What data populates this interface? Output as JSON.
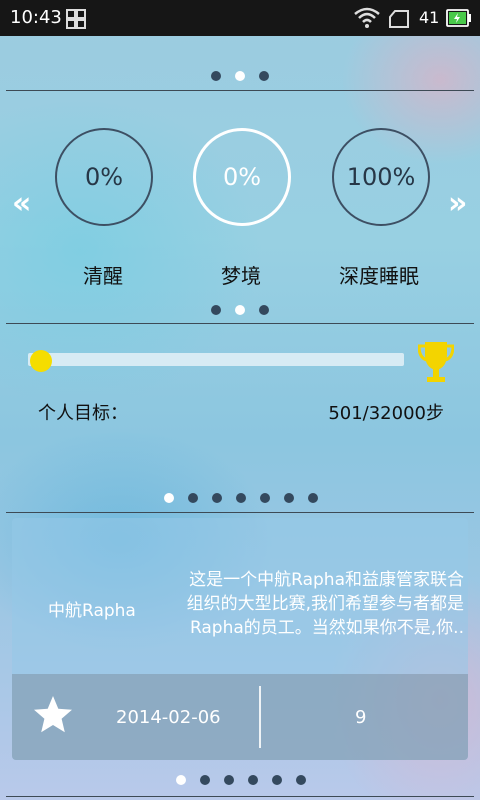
{
  "status_bar": {
    "time": "10:43",
    "battery": "41"
  },
  "sleep": {
    "items": [
      {
        "percent": "0%",
        "label": "清醒"
      },
      {
        "percent": "0%",
        "label": "梦境"
      },
      {
        "percent": "100%",
        "label": "深度睡眠"
      }
    ],
    "prev_arrow": "«",
    "next_arrow": "»"
  },
  "goal": {
    "label": "个人目标：",
    "value": "501/32000步",
    "progress": 0.0157
  },
  "event": {
    "title": "中航Rapha",
    "description_lines": [
      "这是一个中航Rapha和益康管家联合",
      "组织的大型比赛,我们希望参与者都是",
      "Rapha的员工。当然如果你不是,你.."
    ],
    "date": "2014-02-06",
    "count": "9"
  },
  "colors": {
    "accent_yellow": "#f5dd00",
    "battery_green": "#49c94a"
  }
}
